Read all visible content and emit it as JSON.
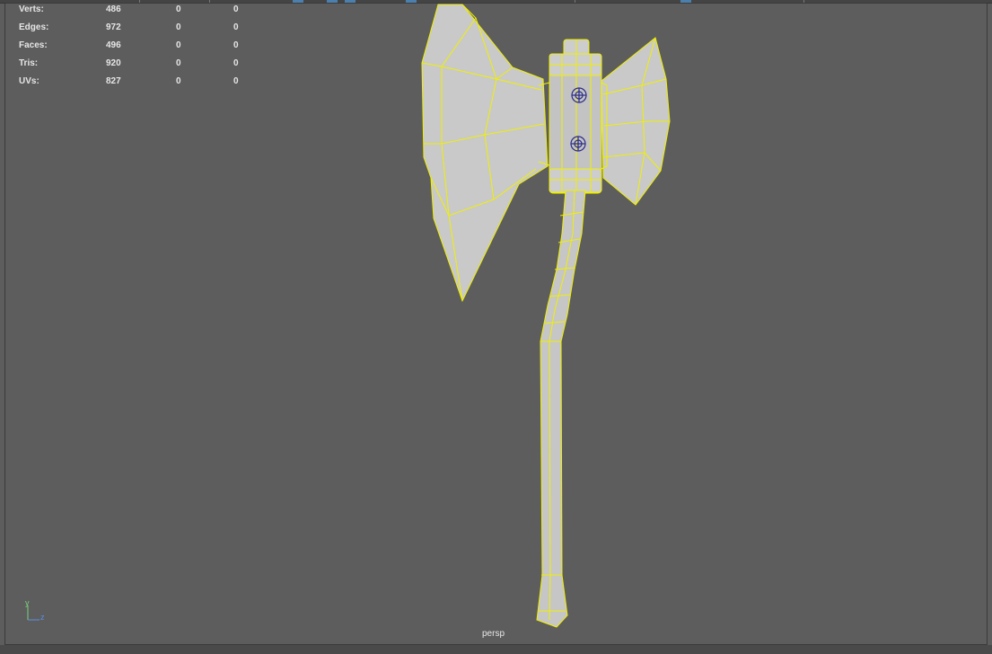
{
  "hud": {
    "rows": [
      {
        "label": "Verts:",
        "v1": "486",
        "v2": "0",
        "v3": "0"
      },
      {
        "label": "Edges:",
        "v1": "972",
        "v2": "0",
        "v3": "0"
      },
      {
        "label": "Faces:",
        "v1": "496",
        "v2": "0",
        "v3": "0"
      },
      {
        "label": "Tris:",
        "v1": "920",
        "v2": "0",
        "v3": "0"
      },
      {
        "label": "UVs:",
        "v1": "827",
        "v2": "0",
        "v3": "0"
      }
    ]
  },
  "viewport": {
    "camera": "persp",
    "axis_y": "y",
    "axis_z": "z"
  },
  "colors": {
    "background": "#5d5d5d",
    "wireframe": "#f0f000",
    "mesh": "#c8c8c8",
    "pivot": "#2a2a8c"
  },
  "icons": [
    "pivot-icon",
    "axis-gizmo-icon"
  ]
}
